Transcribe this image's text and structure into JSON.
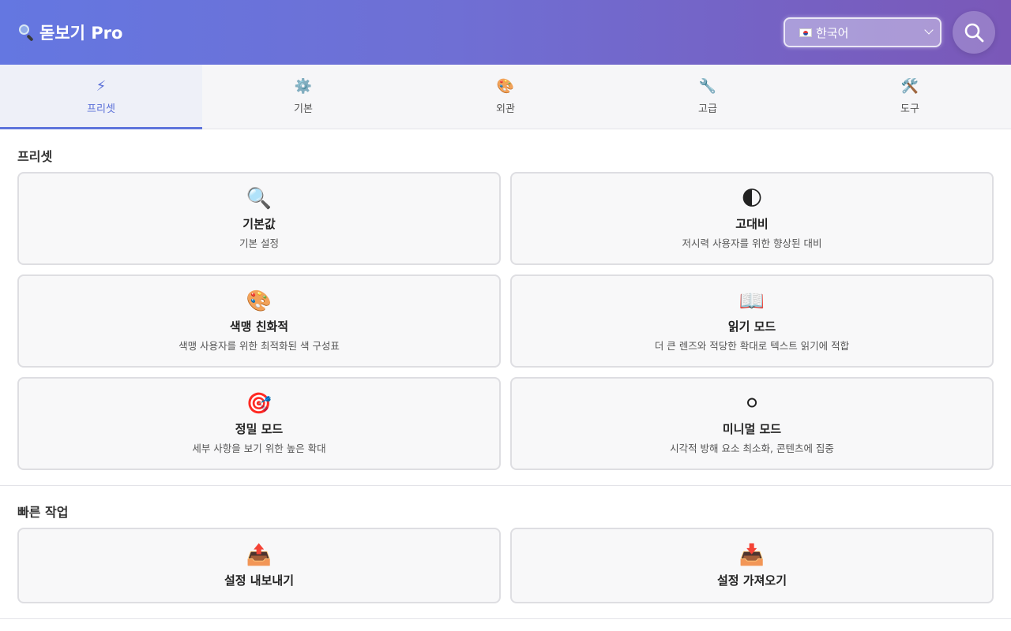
{
  "header": {
    "app_title": "돋보기 Pro",
    "language_selected": "한국어"
  },
  "tabs": [
    {
      "icon": "⚡",
      "label": "프리셋",
      "active": true
    },
    {
      "icon": "⚙️",
      "label": "기본",
      "active": false
    },
    {
      "icon": "🎨",
      "label": "외관",
      "active": false
    },
    {
      "icon": "🔧",
      "label": "고급",
      "active": false
    },
    {
      "icon": "🛠️",
      "label": "도구",
      "active": false
    }
  ],
  "presets": {
    "title": "프리셋",
    "items": [
      {
        "icon": "🔍",
        "title": "기본값",
        "desc": "기본 설정"
      },
      {
        "icon": "🌓",
        "title": "고대비",
        "desc": "저시력 사용자를 위한 향상된 대비"
      },
      {
        "icon": "🎨",
        "title": "색맹 친화적",
        "desc": "색맹 사용자를 위한 최적화된 색 구성표"
      },
      {
        "icon": "📖",
        "title": "읽기 모드",
        "desc": "더 큰 렌즈와 적당한 확대로 텍스트 읽기에 적합"
      },
      {
        "icon": "🎯",
        "title": "정밀 모드",
        "desc": "세부 사항을 보기 위한 높은 확대"
      },
      {
        "icon": "⚪",
        "title": "미니멀 모드",
        "desc": "시각적 방해 요소 최소화, 콘텐츠에 집중"
      }
    ]
  },
  "quick_actions": {
    "title": "빠른 작업",
    "items": [
      {
        "icon": "📤",
        "title": "설정 내보내기"
      },
      {
        "icon": "📥",
        "title": "설정 가져오기"
      }
    ]
  },
  "colors": {
    "header_gradient_start": "#6477e1",
    "header_gradient_end": "#7a58b8",
    "accent": "#5e74dc"
  }
}
